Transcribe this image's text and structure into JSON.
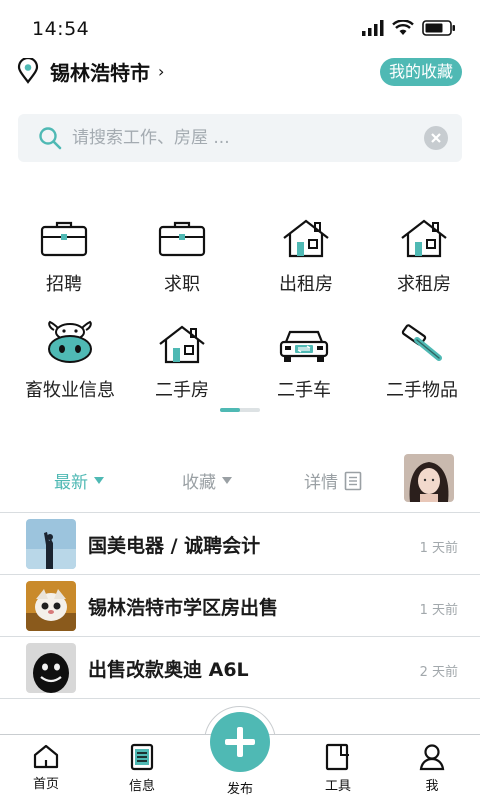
{
  "status": {
    "time": "14:54"
  },
  "header": {
    "city": "锡林浩特市",
    "favorites_label": "我的收藏"
  },
  "search": {
    "placeholder": "请搜索工作、房屋 ..."
  },
  "categories": [
    {
      "label": "招聘",
      "icon": "briefcase-icon"
    },
    {
      "label": "求职",
      "icon": "briefcase-icon"
    },
    {
      "label": "出租房",
      "icon": "house-icon"
    },
    {
      "label": "求租房",
      "icon": "house-icon"
    },
    {
      "label": "畜牧业信息",
      "icon": "cow-icon"
    },
    {
      "label": "二手房",
      "icon": "house-icon"
    },
    {
      "label": "二手车",
      "icon": "car-icon"
    },
    {
      "label": "二手物品",
      "icon": "hammer-icon"
    }
  ],
  "tabs": {
    "latest": "最新",
    "favorites": "收藏",
    "details": "详情"
  },
  "listings": [
    {
      "title": "国美电器 / 诚聘会计",
      "time": "1 天前"
    },
    {
      "title": "锡林浩特市学区房出售",
      "time": "1 天前"
    },
    {
      "title": "出售改款奥迪 A6L",
      "time": "2 天前"
    }
  ],
  "nav": {
    "home": "首页",
    "info": "信息",
    "publish": "发布",
    "tools": "工具",
    "me": "我"
  },
  "colors": {
    "accent": "#4fb9b4",
    "text": "#222222",
    "muted": "#a2a8ac"
  }
}
